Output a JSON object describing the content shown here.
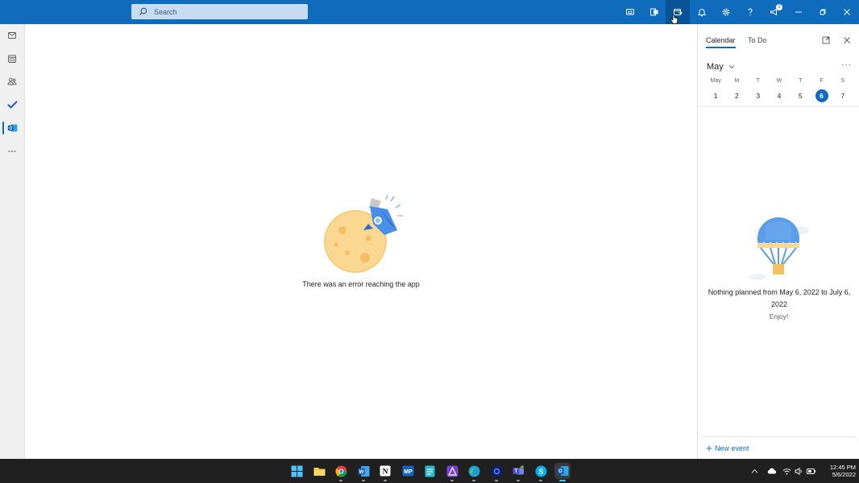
{
  "search": {
    "placeholder": "Search"
  },
  "topbar": {
    "buttons": [
      {
        "icon": "meet-now-icon"
      },
      {
        "icon": "office-apps-icon"
      },
      {
        "icon": "my-day-icon"
      },
      {
        "icon": "bell-icon"
      },
      {
        "icon": "gear-icon"
      },
      {
        "icon": "help-icon"
      },
      {
        "icon": "feedback-icon",
        "badge": "3"
      }
    ],
    "window": [
      "minimize-icon",
      "restore-icon",
      "close-icon"
    ]
  },
  "rail": [
    "mail-icon",
    "calendar-icon",
    "people-icon",
    "todo-icon",
    "outlook-icon",
    "more-icon"
  ],
  "main": {
    "error_text": "There was an error reaching the app"
  },
  "pane": {
    "tabs": [
      {
        "label": "Calendar"
      },
      {
        "label": "To Do"
      }
    ],
    "month": "May",
    "more": "···",
    "days": [
      {
        "name": "May",
        "num": "1"
      },
      {
        "name": "M",
        "num": "2"
      },
      {
        "name": "T",
        "num": "3"
      },
      {
        "name": "W",
        "num": "4"
      },
      {
        "name": "T",
        "num": "5"
      },
      {
        "name": "F",
        "num": "6",
        "today": true
      },
      {
        "name": "S",
        "num": "7"
      }
    ],
    "empty_text": "Nothing planned from May 6, 2022 to July 6, 2022",
    "enjoy": "Enjoy!",
    "new_event": "New event"
  },
  "taskbar": {
    "time": "12:45 PM",
    "date": "5/6/2022",
    "apps": [
      "windows-start-icon",
      "file-explorer-icon",
      "chrome-icon",
      "word-icon",
      "notion-icon",
      "mp-app-icon",
      "notepad-icon",
      "affinity-icon",
      "edge-icon",
      "media-app-icon",
      "teams-icon",
      "skype-icon",
      "outlook-taskbar-icon"
    ],
    "app_labels": {
      "notion": "N",
      "mp": "MP",
      "word": "W",
      "skype": "S"
    }
  },
  "colors": {
    "accent": "#0f6cbd",
    "topbar": "#0f6cbd",
    "taskbar": "#202020"
  }
}
